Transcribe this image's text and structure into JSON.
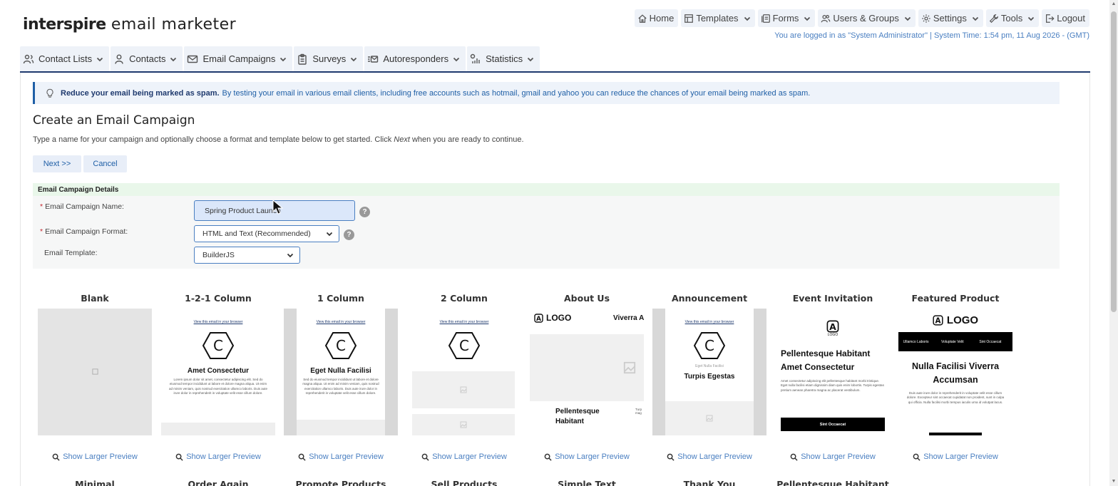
{
  "app": {
    "logo_brand": "interspire",
    "logo_rest": "email marketer"
  },
  "topnav": [
    {
      "label": "Home",
      "icon": "home-icon"
    },
    {
      "label": "Templates",
      "icon": "templates-icon"
    },
    {
      "label": "Forms",
      "icon": "forms-icon"
    },
    {
      "label": "Users & Groups",
      "icon": "users-icon"
    },
    {
      "label": "Settings",
      "icon": "gear-icon"
    },
    {
      "label": "Tools",
      "icon": "wrench-icon"
    },
    {
      "label": "Logout",
      "icon": "logout-icon"
    }
  ],
  "login_info": "You are logged in as \"System Administrator\" | System Time: 1:54 pm, 11 Aug 2026 - (GMT)",
  "mainnav": [
    {
      "label": "Contact Lists",
      "icon": "contact-lists-icon"
    },
    {
      "label": "Contacts",
      "icon": "contact-icon"
    },
    {
      "label": "Email Campaigns",
      "icon": "envelope-icon"
    },
    {
      "label": "Surveys",
      "icon": "clipboard-icon"
    },
    {
      "label": "Autoresponders",
      "icon": "autoresponder-icon"
    },
    {
      "label": "Statistics",
      "icon": "statistics-icon"
    }
  ],
  "tip": {
    "bold": "Reduce your email being marked as spam.",
    "text": "By testing your email in various email clients, including free accounts such as hotmail, gmail and yahoo you can reduce the chances of your email being marked as spam."
  },
  "page": {
    "title": "Create an Email Campaign",
    "intro_before": "Type a name for your campaign and optionally choose a format and template below to get started. Click ",
    "intro_em": "Next",
    "intro_after": " when you are ready to continue.",
    "next_label": "Next >>",
    "cancel_label": "Cancel"
  },
  "details": {
    "heading": "Email Campaign Details",
    "name_label": "Email Campaign Name:",
    "name_value": "Spring Product Launch",
    "format_label": "Email Campaign Format:",
    "format_value": "HTML and Text (Recommended)",
    "template_label": "Email Template:",
    "template_value": "BuilderJS",
    "help_glyph": "?",
    "required_mark": "*"
  },
  "templates": [
    {
      "name": "Blank",
      "preview": "Show Larger Preview"
    },
    {
      "name": "1-2-1 Column",
      "preview": "Show Larger Preview"
    },
    {
      "name": "1 Column",
      "preview": "Show Larger Preview"
    },
    {
      "name": "2 Column",
      "preview": "Show Larger Preview"
    },
    {
      "name": "About Us",
      "preview": "Show Larger Preview"
    },
    {
      "name": "Announcement",
      "preview": "Show Larger Preview"
    },
    {
      "name": "Event Invitation",
      "preview": "Show Larger Preview"
    },
    {
      "name": "Featured Product",
      "preview": "Show Larger Preview"
    }
  ],
  "templates_row2": [
    "Minimal",
    "Order Again",
    "Promote Products",
    "Sell Products",
    "Simple Text",
    "Thank You",
    "Pellentesque Habitant"
  ],
  "thumbs": {
    "view_browser": "View this email in your browser",
    "hex_letter": "C",
    "logo": "LOGO",
    "logo_letter": "A",
    "t121_title": "Amet Consectetur",
    "t121_lorem": "Lorem ipsum dolor sit amet, consectetur adipiscing elit. Sed do eiusmod tempor incididunt ut labore et dolore magna aliqua. Ut enim ad minim veniam, quis nostrud exercitation ullamco laboris. Duis aute irure dolor in reprehenderit in voluptate velit esse cillum dolore.",
    "t1_title": "Eget Nulla Facilisi",
    "t1_lorem": "Sed do eiusmod tempor incididunt ut labore et dolore magna aliqua. Ut enim ad minim veniam, quis nostrud exercitation ullamco laboris. Duis aute irure dolor in reprehenderit in voluptate velit esse cillum dolore.",
    "about_side": "Viverra A",
    "about_title": "Pellentesque Habitant",
    "about_small": "Turp mag",
    "ann_small": "Eget Nulla Facilisi",
    "ann_title": "Turpis Egestas",
    "ev_title": "Pellentesque Habitant Amet Consectetur",
    "ev_lorem": "Amet consectetur adipiscing elit pellentesque habitant morbi tristique. Eget nulla facilisi etiam dignissim diam quis enim lobortis. Turpis egestas pretium aenean pharetra magna ac placerat vestibulum.",
    "ev_button": "Sint Occaecat",
    "fp_bar": [
      "Ullamco Laboris",
      "Voluptate Velit",
      "Sint Occaecat"
    ],
    "fp_title": "Nulla Facilisi Viverra Accumsan",
    "fp_lorem": "Duis aute irure dolor in reprehenderit in voluptate velit esse cillum dolore. Excepteur sint occaecat cupidatat non proident, sunt in culpa qui officia. Nulla facilisi morbi tempus iaculis urna id volutpat lacus."
  },
  "colors": {
    "accent": "#1f5fa6",
    "nav_line": "#1f3a6e",
    "required": "#c4262e",
    "details_head_bg": "#e9f7ea"
  }
}
